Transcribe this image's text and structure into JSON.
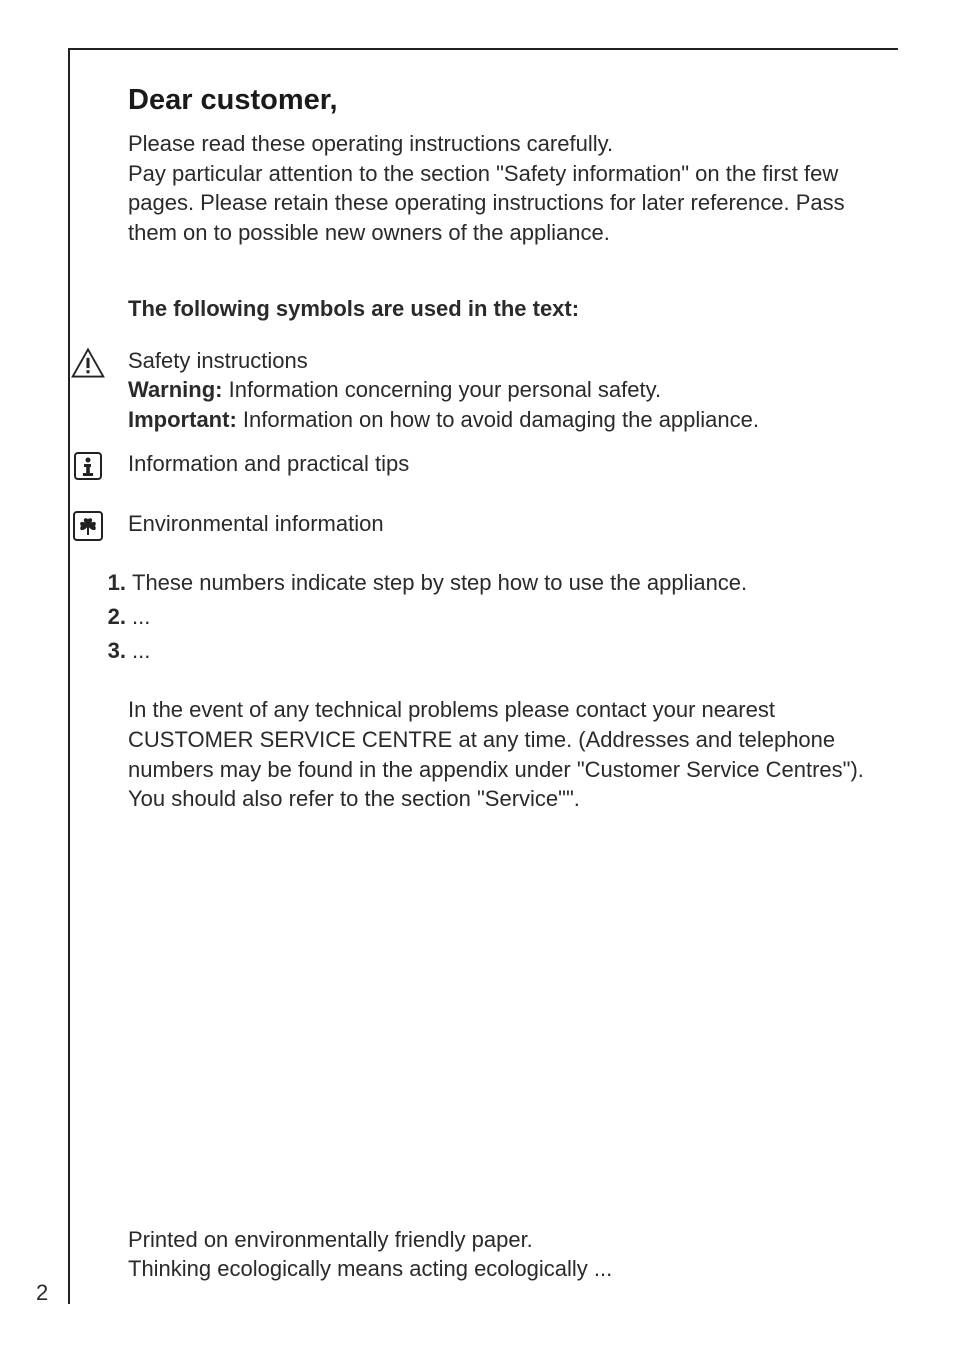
{
  "heading": "Dear customer,",
  "intro": "Please read these operating instructions carefully.\nPay particular attention to the section \"Safety information\" on the first few pages. Please retain these operating instructions for later reference. Pass them on to possible new owners of the appliance.",
  "subheading": "The following symbols are used in the text:",
  "safety": {
    "title": "Safety instructions",
    "warning_label": "Warning:",
    "warning_text": " Information concerning your personal safety.",
    "important_label": "Important:",
    "important_text": " Information on how to avoid damaging the appliance."
  },
  "info_tip": "Information and practical tips",
  "env_info": "Environmental information",
  "steps": [
    {
      "num": "1.",
      "text": "These numbers indicate step by step how to use the appliance."
    },
    {
      "num": "2.",
      "text": "..."
    },
    {
      "num": "3.",
      "text": "..."
    }
  ],
  "closing_p1": "In the event of any technical problems please contact your nearest CUSTOMER SERVICE CENTRE at any time. (Addresses and telephone numbers may be found in the appendix under \"Customer Service Centres\").",
  "closing_p2": "You should also refer to the section \"Service\"\".",
  "footer_line1": "Printed on environmentally friendly paper.",
  "footer_line2": "Thinking ecologically means acting ecologically ...",
  "page_number": "2"
}
